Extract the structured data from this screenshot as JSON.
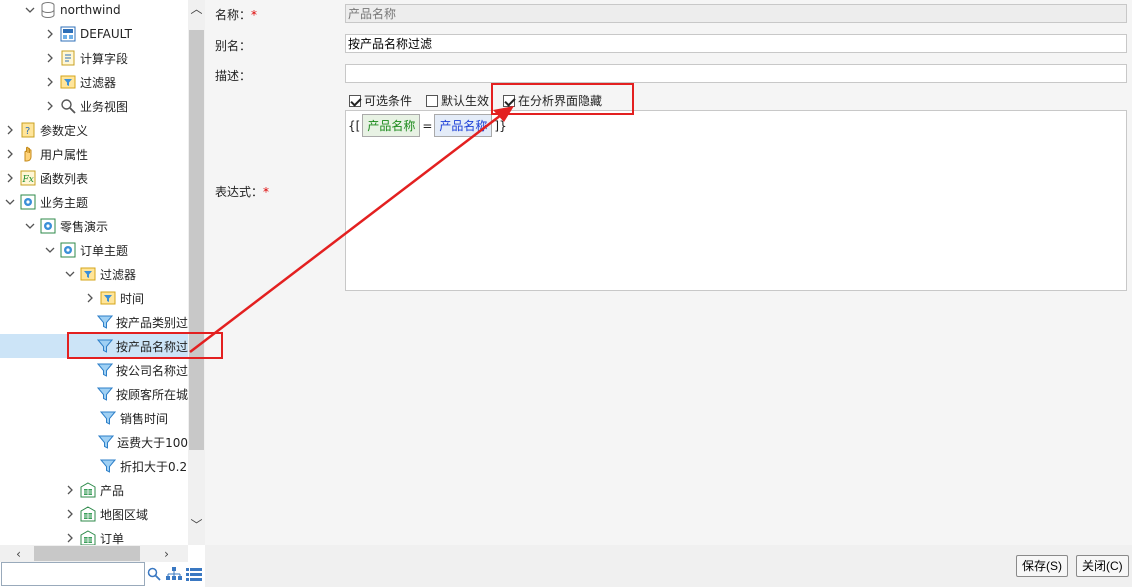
{
  "tree": {
    "items": [
      {
        "label": "northwind",
        "icon": "database-icon",
        "chevron": "down"
      },
      {
        "label": "DEFAULT",
        "icon": "folder-blue-icon",
        "chevron": "right"
      },
      {
        "label": "计算字段",
        "icon": "calc-field-icon",
        "chevron": "right"
      },
      {
        "label": "过滤器",
        "icon": "filter-folder-icon",
        "chevron": "right"
      },
      {
        "label": "业务视图",
        "icon": "search-view-icon",
        "chevron": "right"
      },
      {
        "label": "参数定义",
        "icon": "param-icon",
        "chevron": "right"
      },
      {
        "label": "用户属性",
        "icon": "hand-icon",
        "chevron": "right"
      },
      {
        "label": "函数列表",
        "icon": "fx-icon",
        "chevron": "right"
      },
      {
        "label": "业务主题",
        "icon": "subject-icon",
        "chevron": "down"
      },
      {
        "label": "零售演示",
        "icon": "subject-icon",
        "chevron": "down"
      },
      {
        "label": "订单主题",
        "icon": "subject-icon",
        "chevron": "down"
      },
      {
        "label": "过滤器",
        "icon": "filter-folder-icon",
        "chevron": "down"
      },
      {
        "label": "时间",
        "icon": "filter-folder-icon",
        "chevron": "right"
      },
      {
        "label": "按产品类别过",
        "icon": "filter-icon",
        "chevron": ""
      },
      {
        "label": "按产品名称过",
        "icon": "filter-icon",
        "chevron": "",
        "selected": true
      },
      {
        "label": "按公司名称过",
        "icon": "filter-icon",
        "chevron": ""
      },
      {
        "label": "按顾客所在城",
        "icon": "filter-icon",
        "chevron": ""
      },
      {
        "label": "销售时间",
        "icon": "filter-icon",
        "chevron": ""
      },
      {
        "label": "运费大于100",
        "icon": "filter-icon",
        "chevron": ""
      },
      {
        "label": "折扣大于0.2",
        "icon": "filter-icon",
        "chevron": ""
      },
      {
        "label": "产品",
        "icon": "table-icon",
        "chevron": "right"
      },
      {
        "label": "地图区域",
        "icon": "table-icon",
        "chevron": "right"
      },
      {
        "label": "订单",
        "icon": "table-icon",
        "chevron": "right"
      }
    ],
    "search_value": ""
  },
  "form": {
    "name_label": "名称：",
    "name_value": "产品名称",
    "alias_label": "别名：",
    "alias_value": "按产品名称过滤",
    "desc_label": "描述：",
    "desc_value": "",
    "expr_label": "表达式：",
    "required_mark": "*",
    "checkboxes": [
      {
        "label": "可选条件",
        "checked": true
      },
      {
        "label": "默认生效",
        "checked": false
      },
      {
        "label": "在分析界面隐藏",
        "checked": true
      }
    ],
    "expression": {
      "open": "{[",
      "left_token": "产品名称",
      "operator": "=",
      "right_token": "产品名称",
      "close": "]}"
    }
  },
  "footer": {
    "save_label": "保存(S)",
    "close_label": "关闭(C)"
  },
  "colors": {
    "highlight": "#e32020",
    "selected_row": "#cce4f7",
    "token_green": "#1b8a1b",
    "token_blue": "#1c3fd6"
  }
}
